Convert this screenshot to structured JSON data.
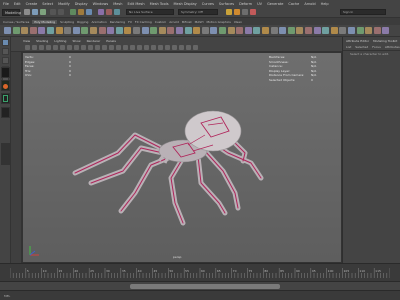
{
  "menubar": {
    "items": [
      "File",
      "Edit",
      "Create",
      "Select",
      "Modify",
      "Display",
      "Windows",
      "Mesh",
      "Edit Mesh",
      "Mesh Tools",
      "Mesh Display",
      "Curves",
      "Surfaces",
      "Deform",
      "UV",
      "Generate",
      "Cache",
      "Arnold",
      "Help"
    ]
  },
  "statusline": {
    "menuset": "Modeling",
    "live_surface": "No Live Surface",
    "symmetry": "Symmetry: Off",
    "signin": "Sign In"
  },
  "shelf": {
    "tabs": [
      "Curves / Surfaces",
      "Poly Modeling",
      "Sculpting",
      "Rigging",
      "Animation",
      "Rendering",
      "FX",
      "FX Caching",
      "Custom",
      "Arnold",
      "Bifrost",
      "MASH",
      "Motion Graphics",
      "XGen"
    ],
    "active_tab": "Poly Modeling"
  },
  "panel": {
    "menus": [
      "View",
      "Shading",
      "Lighting",
      "Show",
      "Renderer",
      "Panels"
    ]
  },
  "viewport": {
    "hud_left": [
      {
        "label": "Verts:",
        "v1": "",
        "v2": "0"
      },
      {
        "label": "Edges:",
        "v1": "",
        "v2": "0"
      },
      {
        "label": "Faces:",
        "v1": "",
        "v2": "0"
      },
      {
        "label": "Tris:",
        "v1": "",
        "v2": "0"
      },
      {
        "label": "UVs:",
        "v1": "",
        "v2": "0"
      }
    ],
    "hud_right": [
      {
        "label": "Backfaces:",
        "value": "N/A"
      },
      {
        "label": "Smoothness:",
        "value": "N/A"
      },
      {
        "label": "Instance:",
        "value": "N/A"
      },
      {
        "label": "Display Layer:",
        "value": "N/A"
      },
      {
        "label": "Distance From Camera:",
        "value": "N/A"
      },
      {
        "label": "Selected Objects:",
        "value": "0"
      }
    ],
    "camera": "persp"
  },
  "attribute_panel": {
    "tabs": [
      "Attribute Editor",
      "Modeling Toolkit",
      "Channel Box / Layer Editor"
    ],
    "subtabs": [
      "List",
      "Selected",
      "Focus",
      "Attributes",
      "Show",
      "Help"
    ],
    "empty_text": "Select a character to edit."
  },
  "timeline": {
    "ticks": [
      "5",
      "10",
      "15",
      "20",
      "25",
      "30",
      "35",
      "40",
      "45",
      "50",
      "55",
      "60",
      "65",
      "70",
      "75",
      "80",
      "85",
      "90",
      "95",
      "100",
      "105",
      "110",
      "115",
      "120"
    ]
  },
  "command": {
    "label": "MEL"
  },
  "colors": {
    "viewport_top": "#6e6e6e",
    "viewport_bottom": "#5e5e5e",
    "spider_body": "#b9b1b6",
    "spider_wire": "#b0245a",
    "accent_selected": "#6a8bb0"
  }
}
